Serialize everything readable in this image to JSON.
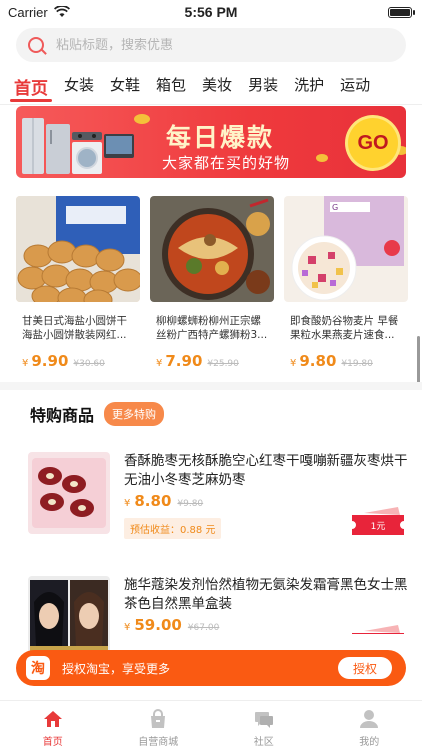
{
  "status": {
    "carrier": "Carrier",
    "time": "5:56 PM"
  },
  "search": {
    "placeholder": "粘贴标题，搜索优惠"
  },
  "tabs": [
    "首页",
    "女装",
    "女鞋",
    "箱包",
    "美妆",
    "男装",
    "洗护",
    "运动"
  ],
  "active_tab": "首页",
  "banner": {
    "title": "每日爆款",
    "subtitle": "大家都在买的好物",
    "go": "GO"
  },
  "daily": [
    {
      "title": "甘美日式海盐小圆饼干 海盐小圆饼散装网红...",
      "yen": "¥",
      "price": "9.90",
      "old_price": "¥30.60"
    },
    {
      "title": "柳柳螺蛳粉柳州正宗螺 丝粉广西特产螺狮粉3...",
      "yen": "¥",
      "price": "7.90",
      "old_price": "¥25.90"
    },
    {
      "title": "即食酸奶谷物麦片 早餐 果粒水果燕麦片速食...",
      "yen": "¥",
      "price": "9.80",
      "old_price": "¥19.80"
    }
  ],
  "special": {
    "title": "特购商品",
    "more": "更多特购",
    "items": [
      {
        "title": "香酥脆枣无核酥脆空心红枣干嘎嘣新疆灰枣烘干无油小冬枣芝麻奶枣",
        "yen": "¥",
        "price": "8.80",
        "old_price": "¥9.80",
        "earn": "预估收益：0.88 元",
        "coupon": "1元"
      },
      {
        "title": "施华蔻染发剂怡然植物无氨染发霜膏黑色女士黑茶色自然黑单盒装",
        "yen": "¥",
        "price": "59.00",
        "old_price": "¥67.00"
      }
    ]
  },
  "auth": {
    "icon": "淘",
    "text": "授权淘宝，享受更多",
    "button": "授权"
  },
  "nav": [
    {
      "label": "首页",
      "icon": "home-icon",
      "active": true
    },
    {
      "label": "自营商城",
      "icon": "shopping-bag-icon",
      "active": false
    },
    {
      "label": "社区",
      "icon": "chat-icon",
      "active": false
    },
    {
      "label": "我的",
      "icon": "user-icon",
      "active": false
    }
  ],
  "colors": {
    "accent": "#e83a3a",
    "price": "#f08a1a",
    "auth_bar": "#fa5a12",
    "more_button": "#f7894a"
  }
}
